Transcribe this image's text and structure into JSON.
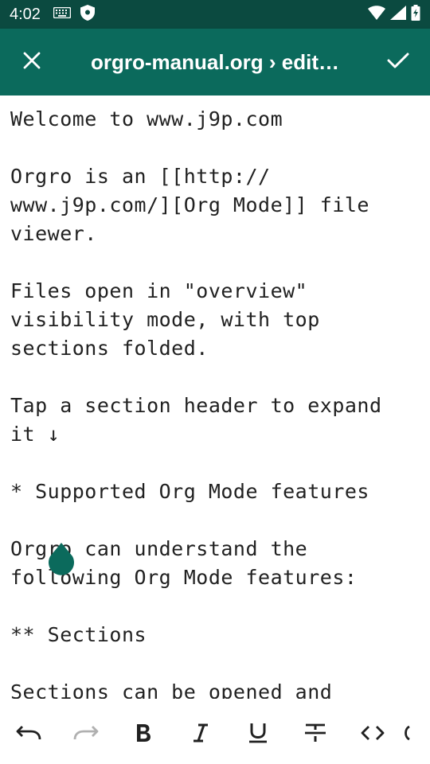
{
  "status_bar": {
    "time": "4:02"
  },
  "app_bar": {
    "title": "orgro-manual.org › edit…"
  },
  "editor": {
    "content": "Welcome to www.j9p.com\n\nOrgro is an [[http://\nwww.j9p.com/][Org Mode]] file\nviewer.\n\nFiles open in \"overview\"\nvisibility mode, with top\nsections folded.\n\nTap a section header to expand\nit ↓\n\n* Supported Org Mode features\n\nOrgro can understand the\nfollowing Org Mode features:\n\n** Sections\n\nSections can be opened and"
  },
  "colors": {
    "status_bar": "#0b4a40",
    "app_bar": "#0b6a5c",
    "handle": "#0b6a5c",
    "text": "#212121",
    "toolbar_icon": "#212121",
    "toolbar_icon_disabled": "#b0b0b0"
  },
  "toolbar": {
    "buttons": [
      {
        "icon": "undo-icon",
        "enabled": true
      },
      {
        "icon": "redo-icon",
        "enabled": false
      },
      {
        "icon": "bold-icon",
        "enabled": true
      },
      {
        "icon": "italic-icon",
        "enabled": true
      },
      {
        "icon": "underline-icon",
        "enabled": true
      },
      {
        "icon": "strikethrough-icon",
        "enabled": true
      },
      {
        "icon": "code-icon",
        "enabled": true
      }
    ]
  }
}
